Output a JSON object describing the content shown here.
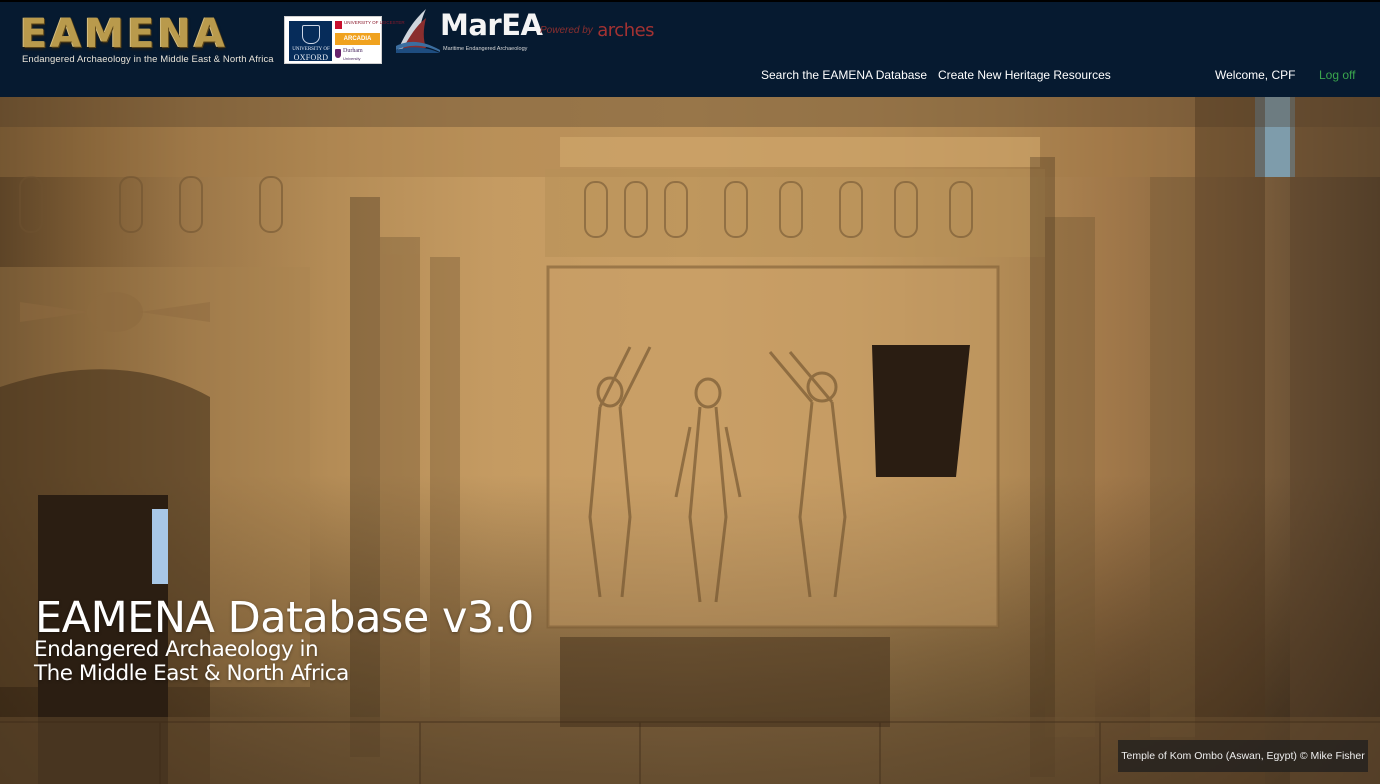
{
  "header": {
    "eamena_logo": {
      "wordmark": "EAMENA",
      "tagline": "Endangered Archaeology in the Middle East & North Africa"
    },
    "partner_logos": {
      "oxford_small": "UNIVERSITY OF",
      "oxford": "OXFORD",
      "leicester": "UNIVERSITY OF LEICESTER",
      "arcadia": "ARCADIA",
      "durham": "Durham",
      "durham_sub": "University"
    },
    "marea_logo": {
      "wordmark": "MarEA",
      "tagline": "Maritime Endangered Archaeology"
    },
    "powered_by": {
      "prefix": "Powered by",
      "name": "arches"
    },
    "nav": {
      "search": "Search the EAMENA Database",
      "create": "Create New Heritage Resources",
      "welcome": "Welcome, CPF",
      "logoff": "Log off"
    }
  },
  "hero": {
    "title": "EAMENA Database v3.0",
    "subtitle_line1": "Endangered Archaeology in",
    "subtitle_line2": "The Middle East & North Africa",
    "caption": "Temple of Kom Ombo (Aswan, Egypt) © Mike Fisher"
  },
  "colors": {
    "header_bg": "#061a30",
    "logoff_link": "#3aa54d",
    "eamena_gold": "#b99a4c",
    "arches_red": "#a33232"
  }
}
